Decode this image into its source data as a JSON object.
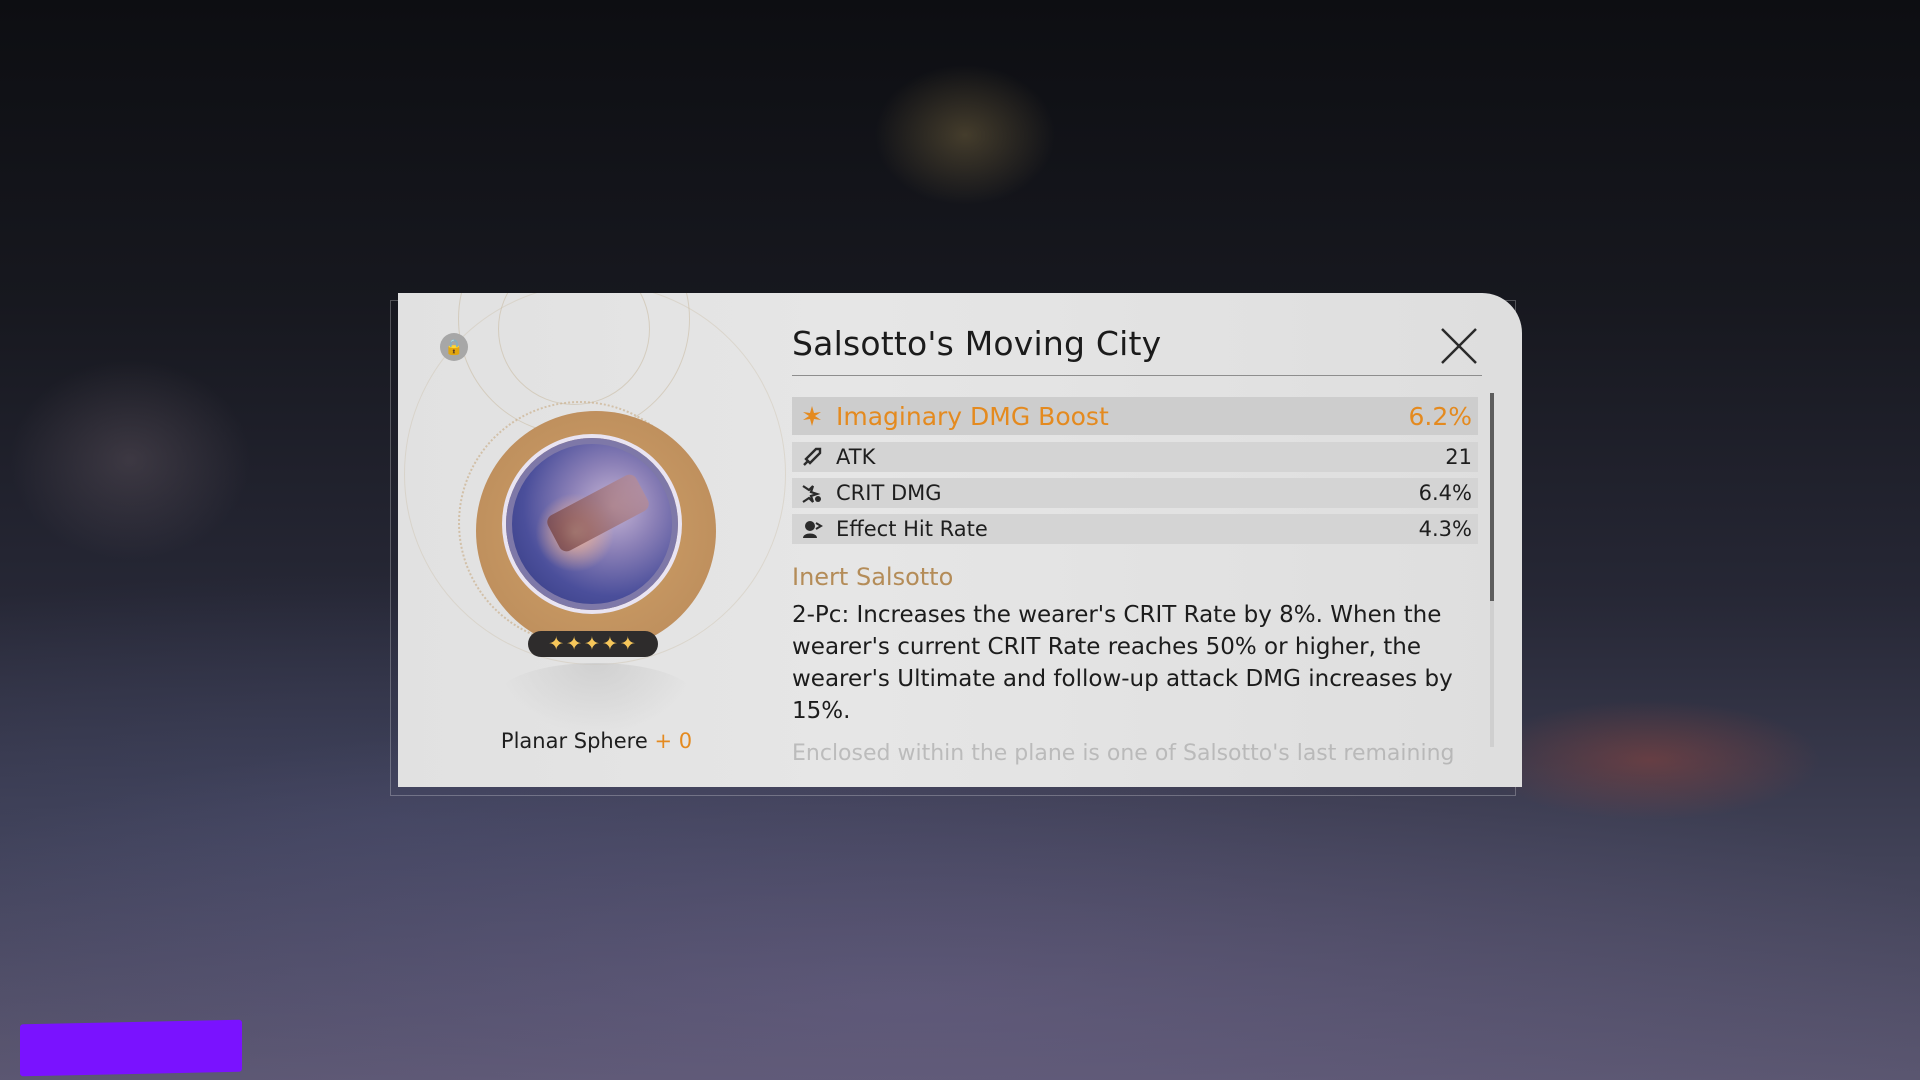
{
  "relic": {
    "name": "Salsotto's Moving City",
    "type_label": "Planar Sphere",
    "level": "+ 0",
    "rarity_stars": "✦✦✦✦✦",
    "main_stat": {
      "name": "Imaginary DMG Boost",
      "value": "6.2%",
      "icon": "imaginary-icon"
    },
    "sub_stats": [
      {
        "name": "ATK",
        "value": "21",
        "icon": "atk-icon"
      },
      {
        "name": "CRIT DMG",
        "value": "6.4%",
        "icon": "crit-dmg-icon"
      },
      {
        "name": "Effect Hit Rate",
        "value": "4.3%",
        "icon": "effect-hit-rate-icon"
      }
    ],
    "set_name": "Inert Salsotto",
    "set_effect": "2-Pc: Increases the wearer's CRIT Rate by 8%. When the wearer's current CRIT Rate reaches 50% or higher, the wearer's Ultimate and follow-up attack DMG increases by 15%.",
    "lore": "Enclosed within the plane is one of Salsotto's last remaining"
  },
  "controls": {
    "lock_icon": "lock-icon",
    "close_icon": "close-icon"
  },
  "colors": {
    "accent_orange": "#e48a1f",
    "set_name_gold": "#b48c58",
    "star_gold": "#f6c65a",
    "redaction": "#7a12ff"
  }
}
